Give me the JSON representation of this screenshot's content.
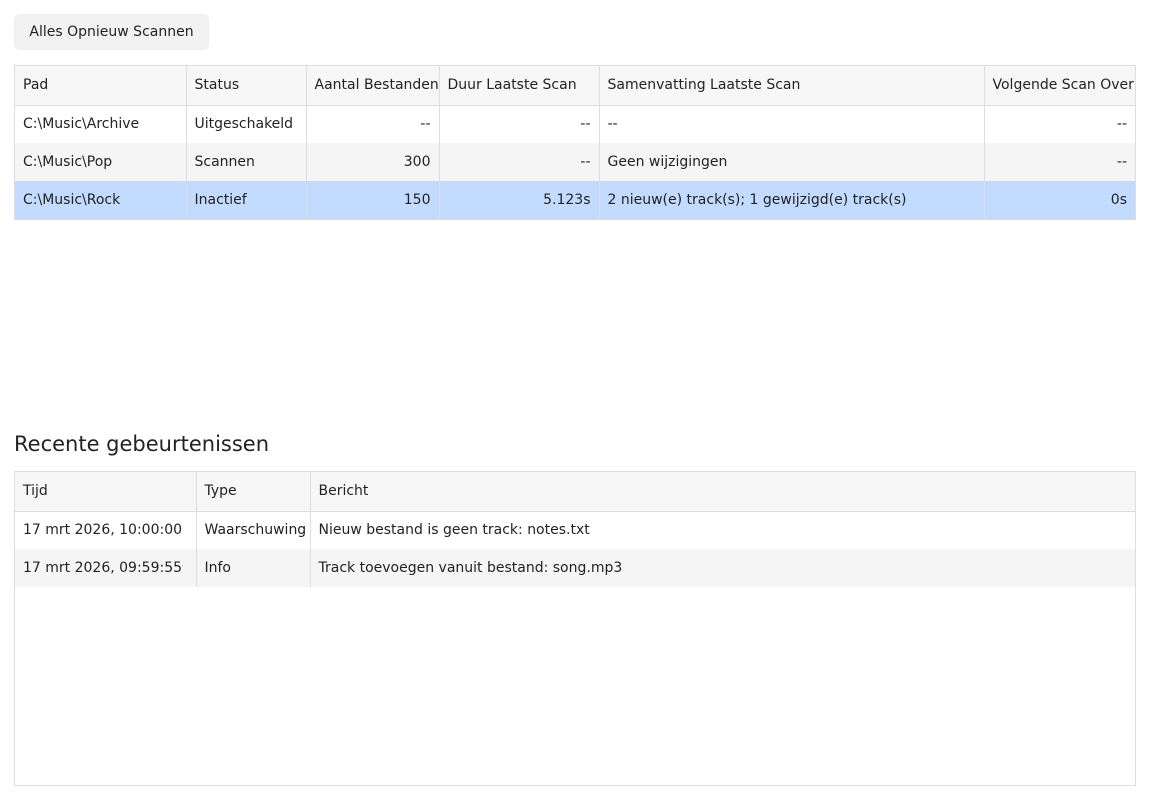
{
  "toolbar": {
    "rescan_all_label": "Alles Opnieuw Scannen"
  },
  "folders": {
    "columns": [
      "Pad",
      "Status",
      "Aantal Bestanden",
      "Duur Laatste Scan",
      "Samenvatting Laatste Scan",
      "Volgende Scan Over"
    ],
    "rows": [
      {
        "path": "C:\\Music\\Archive",
        "status": "Uitgeschakeld",
        "file_count": "--",
        "last_scan_duration": "--",
        "last_scan_summary": "--",
        "next_scan_in": "--",
        "selected": false
      },
      {
        "path": "C:\\Music\\Pop",
        "status": "Scannen",
        "file_count": "300",
        "last_scan_duration": "--",
        "last_scan_summary": "Geen wijzigingen",
        "next_scan_in": "--",
        "selected": false
      },
      {
        "path": "C:\\Music\\Rock",
        "status": "Inactief",
        "file_count": "150",
        "last_scan_duration": "5.123s",
        "last_scan_summary": "2 nieuw(e) track(s); 1 gewijzigd(e) track(s)",
        "next_scan_in": "0s",
        "selected": true
      }
    ]
  },
  "events": {
    "title": "Recente gebeurtenissen",
    "columns": [
      "Tijd",
      "Type",
      "Bericht"
    ],
    "rows": [
      {
        "time": "17 mrt 2026, 10:00:00",
        "type": "Waarschuwing",
        "message": "Nieuw bestand is geen track: notes.txt"
      },
      {
        "time": "17 mrt 2026, 09:59:55",
        "type": "Info",
        "message": "Track toevoegen vanuit bestand: song.mp3"
      }
    ]
  },
  "colors": {
    "selected_row": "#c2dbff",
    "zebra_row": "#f5f5f5",
    "header_bg": "#f7f7f8",
    "border": "#dddddd"
  }
}
